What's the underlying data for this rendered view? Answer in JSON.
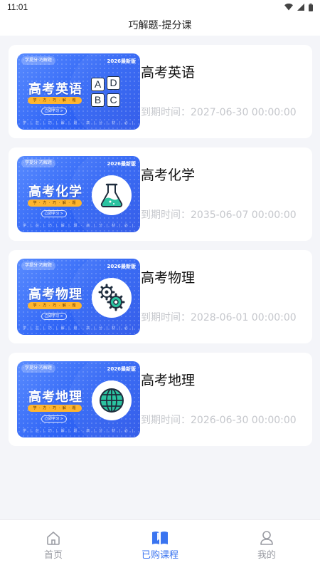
{
  "status_bar": {
    "time": "11:01"
  },
  "header": {
    "title": "巧解题-提分课"
  },
  "courses": [
    {
      "name": "高考英语",
      "expiry": "到期时间：2027-06-30 00:00:00",
      "thumb": {
        "brand": "学提分·巧解题",
        "edition": "2026最新版",
        "title": "高考英语",
        "tagline": "学 · 方 · 巧 · 解 · 题",
        "button": "立即学习 >",
        "footer": "学 | 在 | 巧 | 解 | 题 · 高 | 分 | 材 | 必 | 修",
        "letters": [
          "A",
          "D",
          "B",
          "C"
        ],
        "icon": "abcd-tiles-icon"
      }
    },
    {
      "name": "高考化学",
      "expiry": "到期时间：2035-06-07 00:00:00",
      "thumb": {
        "brand": "学提分·巧解题",
        "edition": "2026最新版",
        "title": "高考化学",
        "tagline": "学 · 方 · 巧 · 解 · 题",
        "button": "立即学习 >",
        "footer": "学 | 在 | 巧 | 解 | 题 · 高 | 分 | 材 | 必 | 修",
        "icon": "flask-icon"
      }
    },
    {
      "name": "高考物理",
      "expiry": "到期时间：2028-06-01 00:00:00",
      "thumb": {
        "brand": "学提分·巧解题",
        "edition": "2026最新版",
        "title": "高考物理",
        "tagline": "学 · 方 · 巧 · 解 · 题",
        "button": "立即学习 >",
        "footer": "学 | 在 | 巧 | 解 | 题 · 高 | 分 | 材 | 必 | 修",
        "icon": "gears-icon"
      }
    },
    {
      "name": "高考地理",
      "expiry": "到期时间：2026-06-30 00:00:00",
      "thumb": {
        "brand": "学提分·巧解题",
        "edition": "2026最新版",
        "title": "高考地理",
        "tagline": "学 · 方 · 巧 · 解 · 题",
        "button": "立即学习 >",
        "footer": "学 | 在 | 巧 | 解 | 题 · 高 | 分 | 材 | 必 | 修",
        "icon": "globe-icon"
      }
    }
  ],
  "tab_bar": {
    "tabs": [
      {
        "label": "首页",
        "icon": "home-icon",
        "active": false
      },
      {
        "label": "已购课程",
        "icon": "book-icon",
        "active": true
      },
      {
        "label": "我的",
        "icon": "profile-icon",
        "active": false
      }
    ]
  },
  "colors": {
    "accent": "#3a74f0",
    "thumb_blue": "#2f64f5",
    "tag_orange": "#ffb52e",
    "icon_teal": "#2bc3a0",
    "muted_text": "#c5c7cc"
  }
}
